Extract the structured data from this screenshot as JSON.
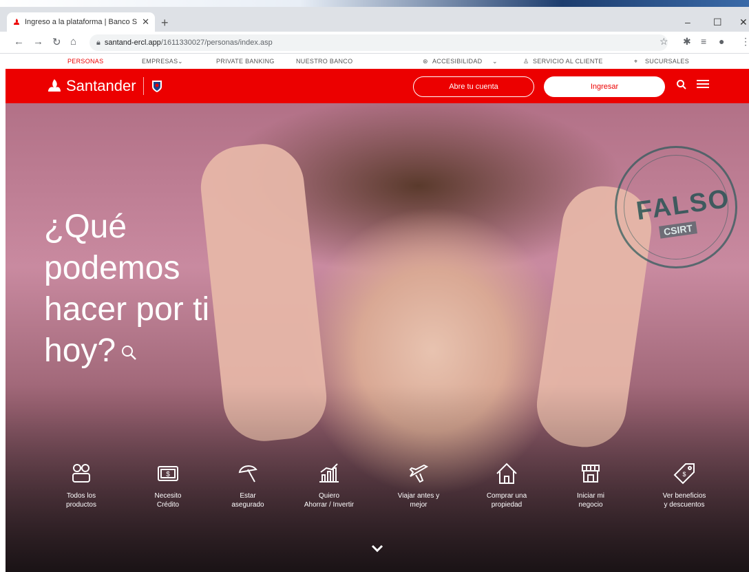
{
  "browser": {
    "tab_title": "Ingreso a la plataforma | Banco S",
    "tab_close": "✕",
    "new_tab": "+",
    "url_host": "santand-ercl.app",
    "url_path": "/1611330027/personas/index.asp",
    "controls": {
      "minimize": "–",
      "maximize": "☐",
      "close": "✕"
    }
  },
  "topnav": {
    "items": [
      "PERSONAS",
      "EMPRESAS",
      "PRIVATE BANKING",
      "NUESTRO BANCO",
      "ACCESIBILIDAD",
      "SERVICIO AL CLIENTE",
      "SUCURSALES"
    ]
  },
  "header": {
    "brand": "Santander",
    "open_account": "Abre tu cuenta",
    "login": "Ingresar"
  },
  "hero": {
    "line1": "¿Qué",
    "line2": "podemos",
    "line3": "hacer por ti",
    "line4": "hoy?"
  },
  "stamp": {
    "text": "FALSO",
    "org": "CSIRT"
  },
  "features": [
    {
      "line1": "Todos los",
      "line2": "productos",
      "icon": "products-icon"
    },
    {
      "line1": "Necesito",
      "line2": "Crédito",
      "icon": "money-icon"
    },
    {
      "line1": "Estar",
      "line2": "asegurado",
      "icon": "umbrella-icon"
    },
    {
      "line1": "Quiero",
      "line2": "Ahorrar / Invertir",
      "icon": "chart-icon"
    },
    {
      "line1": "Viajar antes y",
      "line2": "mejor",
      "icon": "plane-icon"
    },
    {
      "line1": "Comprar una",
      "line2": "propiedad",
      "icon": "house-icon"
    },
    {
      "line1": "Iniciar mi",
      "line2": "negocio",
      "icon": "store-icon"
    },
    {
      "line1": "Ver beneficios",
      "line2": "y descuentos",
      "icon": "tag-icon"
    }
  ],
  "colors": {
    "brand_red": "#ec0000"
  }
}
